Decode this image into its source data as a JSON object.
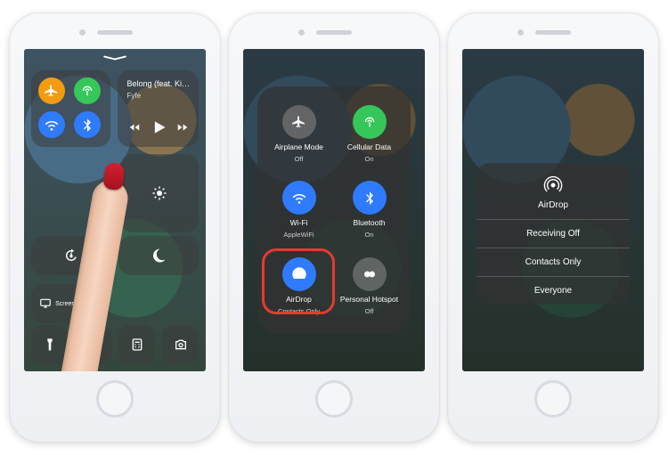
{
  "phone1": {
    "connectivity": {
      "airplane": {
        "label": "Airplane",
        "on": true
      },
      "cellular": {
        "label": "Cellular",
        "on": true
      },
      "wifi": {
        "label": "Wi-Fi",
        "on": true
      },
      "bluetooth": {
        "label": "Bluetooth",
        "on": true
      }
    },
    "music": {
      "title": "Belong (feat. Ki…",
      "artist": "Fyfe"
    },
    "rotation_lock_label": "",
    "dnd_label": "",
    "screen_mirroring_label": "Screen Mirroring",
    "torch_label": "",
    "timer_label": ""
  },
  "phone2": {
    "items": {
      "airplane": {
        "label": "Airplane Mode",
        "sub": "Off",
        "on": false
      },
      "cellular": {
        "label": "Cellular Data",
        "sub": "On",
        "on": true
      },
      "wifi": {
        "label": "Wi-Fi",
        "sub": "AppleWiFi",
        "on": true
      },
      "bluetooth": {
        "label": "Bluetooth",
        "sub": "On",
        "on": true
      },
      "airdrop": {
        "label": "AirDrop",
        "sub": "Contacts Only",
        "on": true
      },
      "hotspot": {
        "label": "Personal Hotspot",
        "sub": "Off",
        "on": false
      }
    }
  },
  "phone3": {
    "title": "AirDrop",
    "options": {
      "off": "Receiving Off",
      "contacts": "Contacts Only",
      "everyone": "Everyone"
    }
  }
}
